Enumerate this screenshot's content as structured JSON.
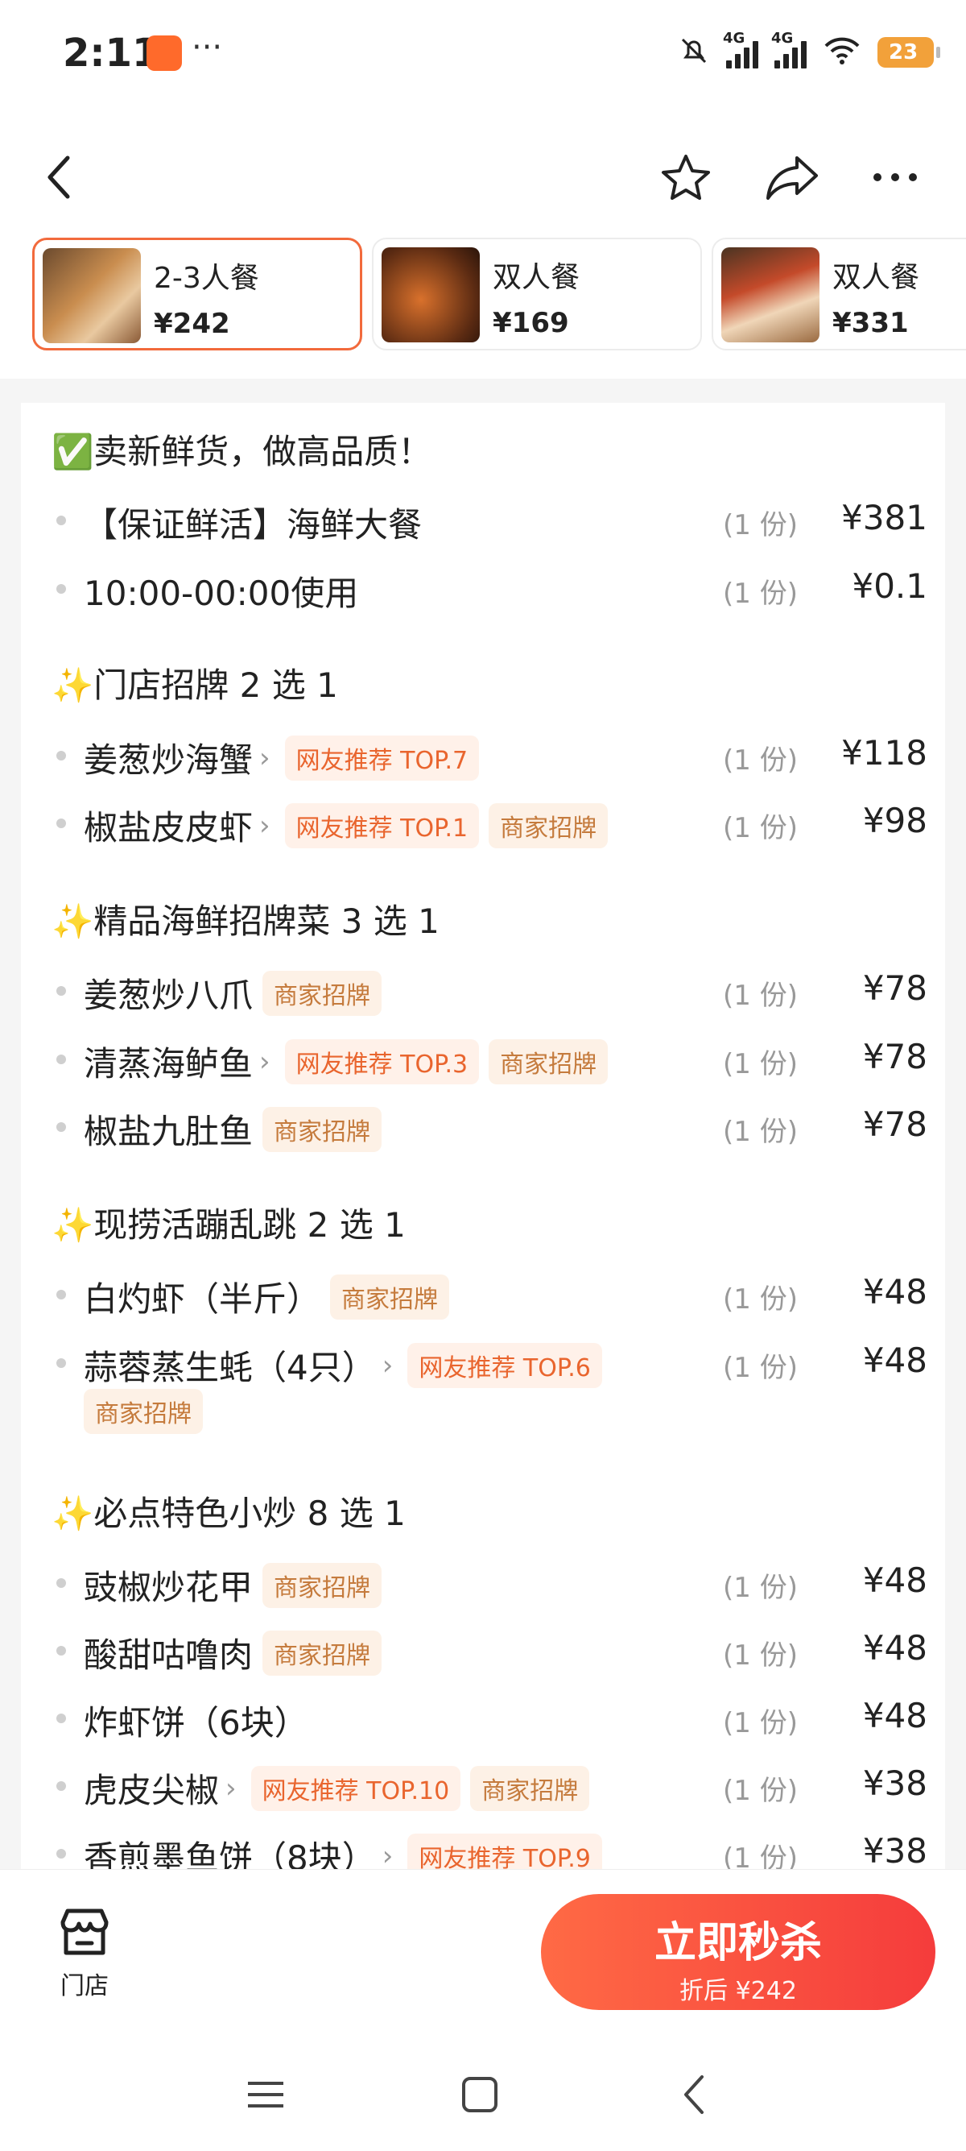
{
  "status_bar": {
    "time": "2:11",
    "more": "···",
    "net1": "4G",
    "net2": "4G",
    "battery": "23"
  },
  "packages": [
    {
      "name": "2-3人餐",
      "price": "¥242",
      "selected": true
    },
    {
      "name": "双人餐",
      "price": "¥169",
      "selected": false
    },
    {
      "name": "双人餐",
      "price": "¥331",
      "selected": false
    }
  ],
  "sections": [
    {
      "title": "✅卖新鲜货，做高品质！",
      "items": [
        {
          "name": "【保证鲜活】海鲜大餐",
          "qty": "(1 份)",
          "price": "¥381"
        },
        {
          "name": "10:00-00:00使用",
          "qty": "(1 份)",
          "price": "¥0.1"
        }
      ]
    },
    {
      "title": "✨门店招牌 2 选 1",
      "items": [
        {
          "name": "姜葱炒海蟹",
          "qty": "(1 份)",
          "price": "¥118",
          "tags": [
            "网友推荐 TOP.7"
          ]
        },
        {
          "name": "椒盐皮皮虾",
          "qty": "(1 份)",
          "price": "¥98",
          "tags": [
            "网友推荐 TOP.1",
            "商家招牌"
          ]
        }
      ]
    },
    {
      "title": "✨精品海鲜招牌菜 3 选 1",
      "items": [
        {
          "name": "姜葱炒八爪",
          "qty": "(1 份)",
          "price": "¥78",
          "tags": [
            "商家招牌"
          ]
        },
        {
          "name": "清蒸海鲈鱼",
          "qty": "(1 份)",
          "price": "¥78",
          "tags": [
            "网友推荐 TOP.3",
            "商家招牌"
          ]
        },
        {
          "name": "椒盐九肚鱼",
          "qty": "(1 份)",
          "price": "¥78",
          "tags": [
            "商家招牌"
          ]
        }
      ]
    },
    {
      "title": "✨现捞活蹦乱跳 2 选 1",
      "items": [
        {
          "name": "白灼虾（半斤）",
          "qty": "(1 份)",
          "price": "¥48",
          "tags": [
            "商家招牌"
          ]
        },
        {
          "name": "蒜蓉蒸生蚝（4只）",
          "qty": "(1 份)",
          "price": "¥48",
          "tags": [
            "网友推荐 TOP.6",
            "商家招牌"
          ]
        }
      ]
    },
    {
      "title": "✨必点特色小炒 8 选 1",
      "items": [
        {
          "name": "豉椒炒花甲",
          "qty": "(1 份)",
          "price": "¥48",
          "tags": [
            "商家招牌"
          ]
        },
        {
          "name": "酸甜咕噜肉",
          "qty": "(1 份)",
          "price": "¥48",
          "tags": [
            "商家招牌"
          ]
        },
        {
          "name": "炸虾饼（6块）",
          "qty": "(1 份)",
          "price": "¥48"
        },
        {
          "name": "虎皮尖椒",
          "qty": "(1 份)",
          "price": "¥38",
          "tags": [
            "网友推荐 TOP.10",
            "商家招牌"
          ]
        },
        {
          "name": "香煎墨鱼饼（8块）",
          "qty": "(1 份)",
          "price": "¥38",
          "tags": [
            "网友推荐 TOP.9"
          ]
        }
      ]
    }
  ],
  "bottom": {
    "store_label": "门店",
    "cta_main": "立即秒杀",
    "cta_sub": "折后 ¥242"
  },
  "colors": {
    "accent": "#f26a3c",
    "cta_start": "#ff6a45",
    "cta_end": "#f53c3c",
    "tag_text": "#e9652e",
    "tag_bg": "#fff1e9"
  }
}
